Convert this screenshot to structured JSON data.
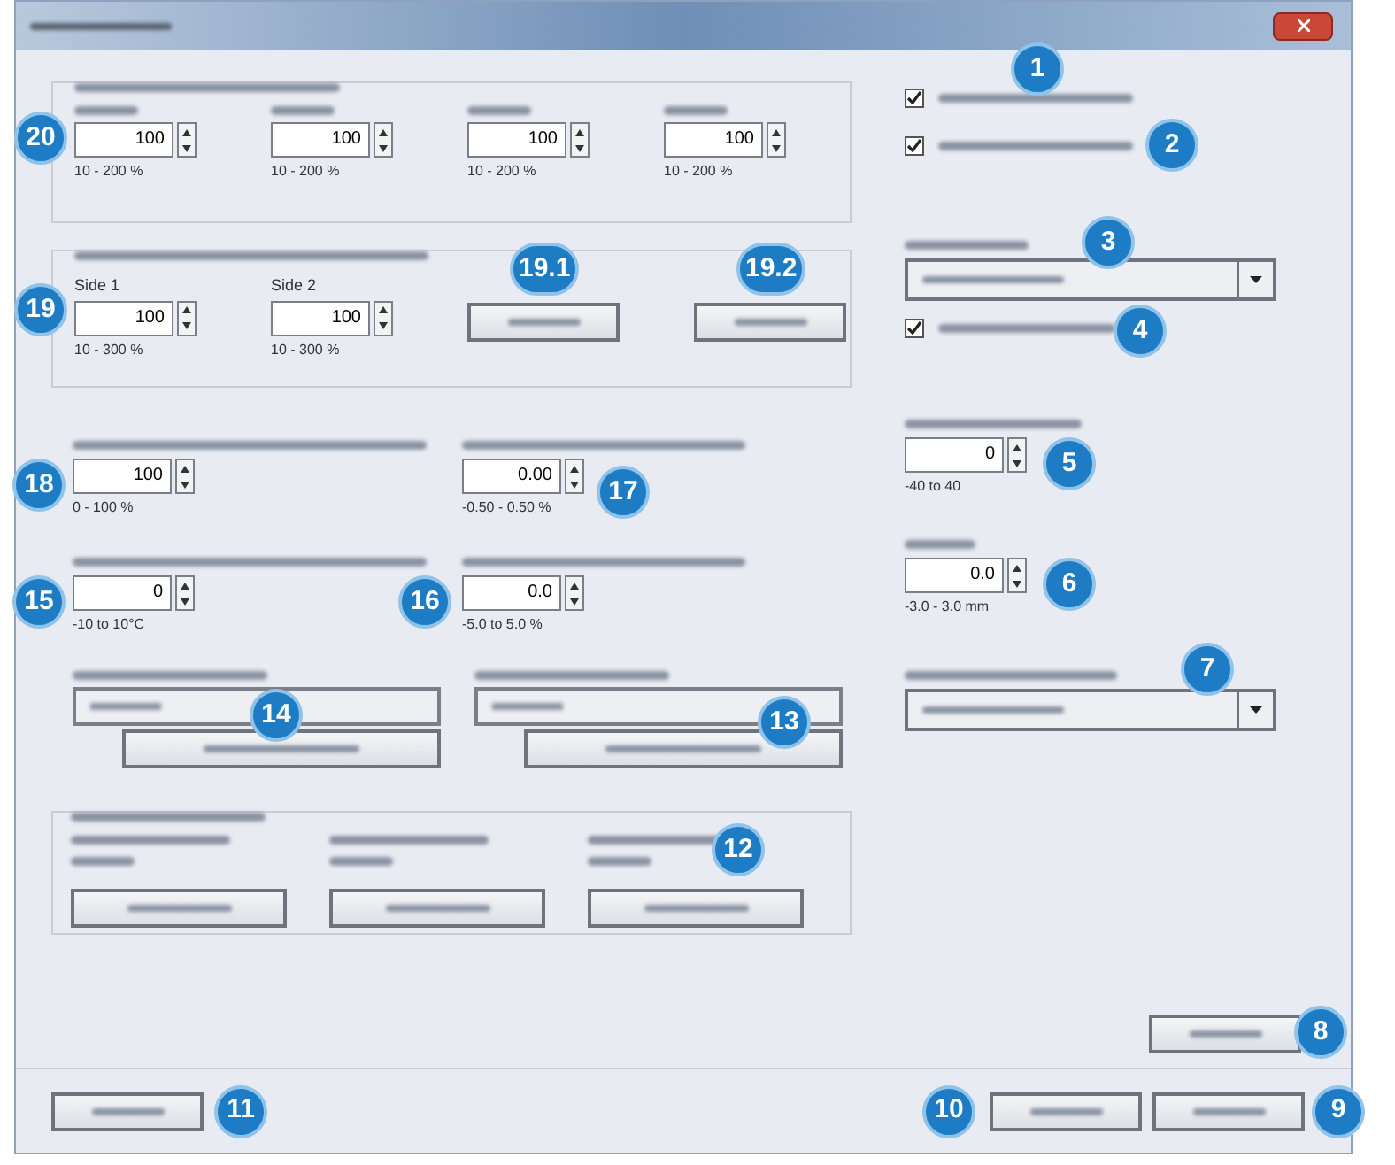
{
  "color_group": {
    "callout": "20",
    "fields": [
      {
        "value": "100",
        "range": "10 - 200 %"
      },
      {
        "value": "100",
        "range": "10 - 200 %"
      },
      {
        "value": "100",
        "range": "10 - 200 %"
      },
      {
        "value": "100",
        "range": "10 - 200 %"
      }
    ]
  },
  "side_group": {
    "callout": "19",
    "fields": [
      {
        "label": "Side 1",
        "value": "100",
        "range": "10 - 300 %"
      },
      {
        "label": "Side 2",
        "value": "100",
        "range": "10 - 300 %"
      }
    ],
    "buttons": [
      {
        "callout": "19.1"
      },
      {
        "callout": "19.2"
      }
    ]
  },
  "options": [
    {
      "checked": true,
      "callout": "1"
    },
    {
      "checked": true,
      "callout": "2"
    }
  ],
  "dropdown_top": {
    "callout": "3"
  },
  "option_below": {
    "checked": true,
    "callout": "4"
  },
  "right_fields": [
    {
      "value": "0",
      "range": "-40 to 40",
      "callout": "5"
    },
    {
      "value": "0.0",
      "range": "-3.0 - 3.0 mm",
      "callout": "6"
    }
  ],
  "dropdown_bottom": {
    "callout": "7"
  },
  "left_fields": [
    {
      "value": "100",
      "range": "0 - 100 %",
      "callout": "18"
    },
    {
      "value": "0.00",
      "range": "-0.50 - 0.50 %",
      "callout": "17"
    },
    {
      "value": "0",
      "range": "-10 to 10°C",
      "callout": "15"
    },
    {
      "value": "0.0",
      "range": "-5.0 to 5.0 %",
      "callout": "16"
    }
  ],
  "browse_rows": [
    {
      "callout": "14"
    },
    {
      "callout": "13"
    }
  ],
  "bottom_group": {
    "callout": "12"
  },
  "side_button": {
    "callout": "8"
  },
  "footer": {
    "left_callout": "11",
    "buttons": [
      {
        "callout": "10"
      },
      {
        "callout": "9"
      }
    ]
  }
}
